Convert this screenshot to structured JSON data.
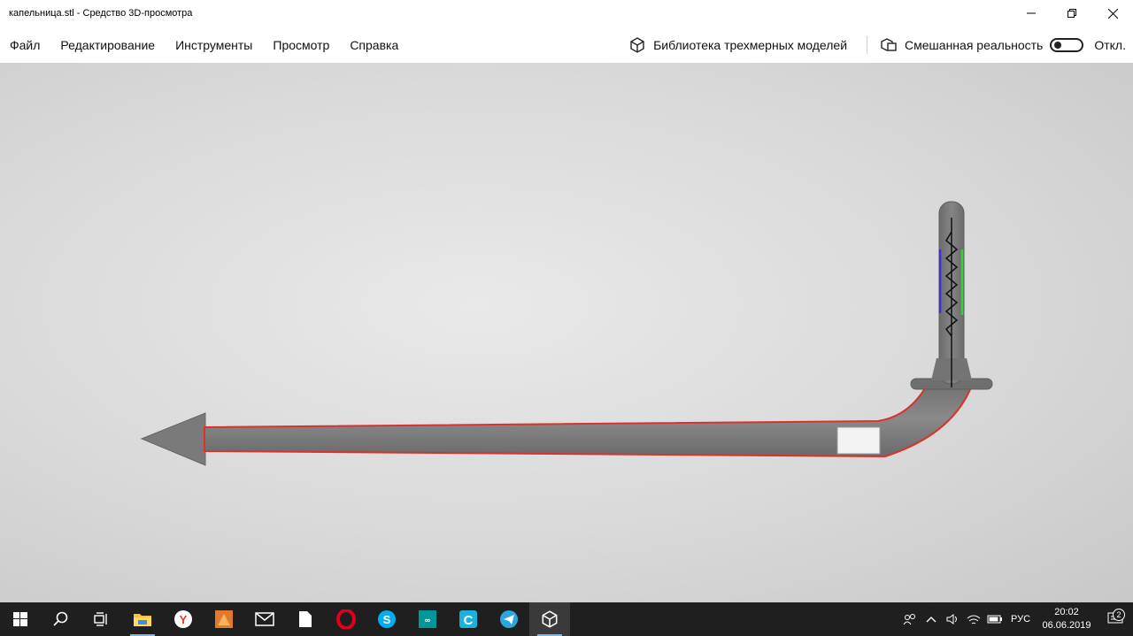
{
  "window": {
    "title": "капельница.stl - Средство 3D-просмотра"
  },
  "menu": {
    "items": [
      "Файл",
      "Редактирование",
      "Инструменты",
      "Просмотр",
      "Справка"
    ],
    "library_label": "Библиотека трехмерных моделей",
    "mixed_reality_label": "Смешанная реальность",
    "mixed_reality_state": "Откл."
  },
  "viewport": {
    "model_color": "#777777",
    "outline_color": "#d9332a",
    "blue_mark_color": "#3a2fd6",
    "green_mark_color": "#39d13a"
  },
  "taskbar": {
    "apps": [
      "start-icon",
      "search-icon",
      "task-view-icon",
      "file-explorer-icon",
      "yandex-browser-icon",
      "matlab-icon",
      "mail-icon",
      "file-icon",
      "opera-icon",
      "skype-icon",
      "arduino-icon",
      "ccleaner-icon",
      "telegram-icon",
      "3d-viewer-icon"
    ],
    "language": "РУС",
    "time": "20:02",
    "date": "06.06.2019",
    "notifications": "2"
  }
}
